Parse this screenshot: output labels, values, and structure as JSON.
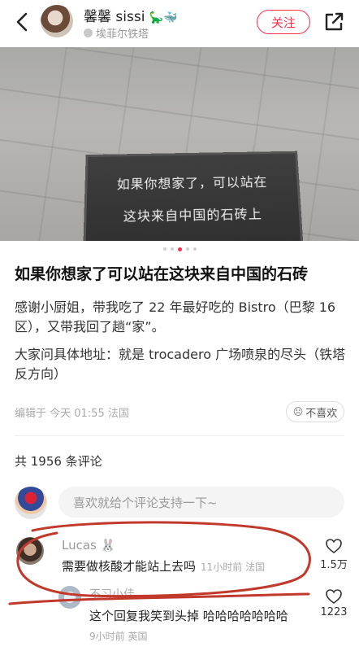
{
  "header": {
    "author_name": "馨馨 sissi",
    "author_name_deco": "🦕🐳",
    "location": "埃菲尔铁塔",
    "follow_label": "关注"
  },
  "photo": {
    "stone_line_1": "如果你想家了，可以站在",
    "stone_line_2": "这块来自中国的石砖上"
  },
  "post": {
    "title": "如果你想家了可以站在这块来自中国的石砖",
    "paragraph_1": "感谢小厨姐，带我吃了 22 年最好吃的 Bistro（巴黎 16 区），又带我回了趟“家”。",
    "paragraph_2": "大家问具体地址：就是 trocadero 广场喷泉的尽头（铁塔反方向）",
    "meta": "编辑于 今天 01:55 法国",
    "dislike_label": "不喜欢"
  },
  "comments_section": {
    "count_label": "共 1956 条评论",
    "input_placeholder": "喜欢就给个评论支持一下~",
    "comments": [
      {
        "user": "Lucas 🐰",
        "text": "需要做核酸才能站上去吗",
        "meta": "11小时前 法国",
        "likes": "1.5万"
      },
      {
        "user": "不习小佳",
        "text": "这个回复我笑到头掉 哈哈哈哈哈哈哈",
        "meta": "9小时前 英国",
        "likes": "1223"
      }
    ]
  },
  "colors": {
    "accent": "#ff2e4d",
    "annotation": "#c0392b"
  }
}
